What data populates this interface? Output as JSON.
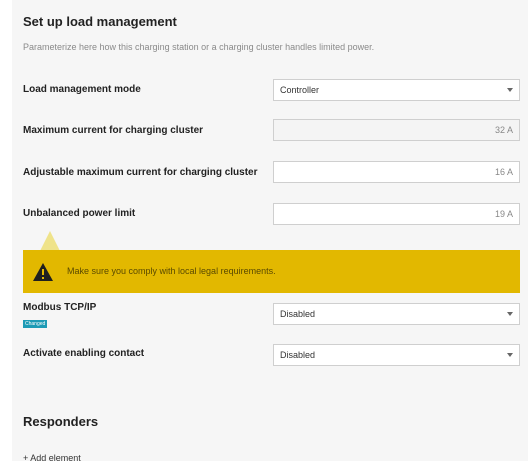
{
  "header": {
    "title": "Set up load management",
    "subtitle": "Parameterize here how this charging station or a charging cluster handles limited power."
  },
  "fields": {
    "mode": {
      "label": "Load management mode",
      "value": "Controller"
    },
    "max_current": {
      "label": "Maximum current for charging cluster",
      "value": "32 A"
    },
    "adjustable_max_current": {
      "label": "Adjustable maximum current for charging cluster",
      "value": "16 A"
    },
    "unbalanced_limit": {
      "label": "Unbalanced power limit",
      "value": "19 A"
    },
    "modbus": {
      "label": "Modbus TCP/IP",
      "badge": "Changed",
      "value": "Disabled"
    },
    "enabling_contact": {
      "label": "Activate enabling contact",
      "value": "Disabled"
    }
  },
  "warning": {
    "text": "Make sure you comply with local legal requirements.",
    "icon": "warning-triangle-icon",
    "color": "#e2b800"
  },
  "responders": {
    "title": "Responders",
    "add_label": "+ Add element"
  },
  "colors": {
    "panel_bg": "#f6f6f6",
    "warning": "#e2b800",
    "badge": "#1d9bb5"
  }
}
